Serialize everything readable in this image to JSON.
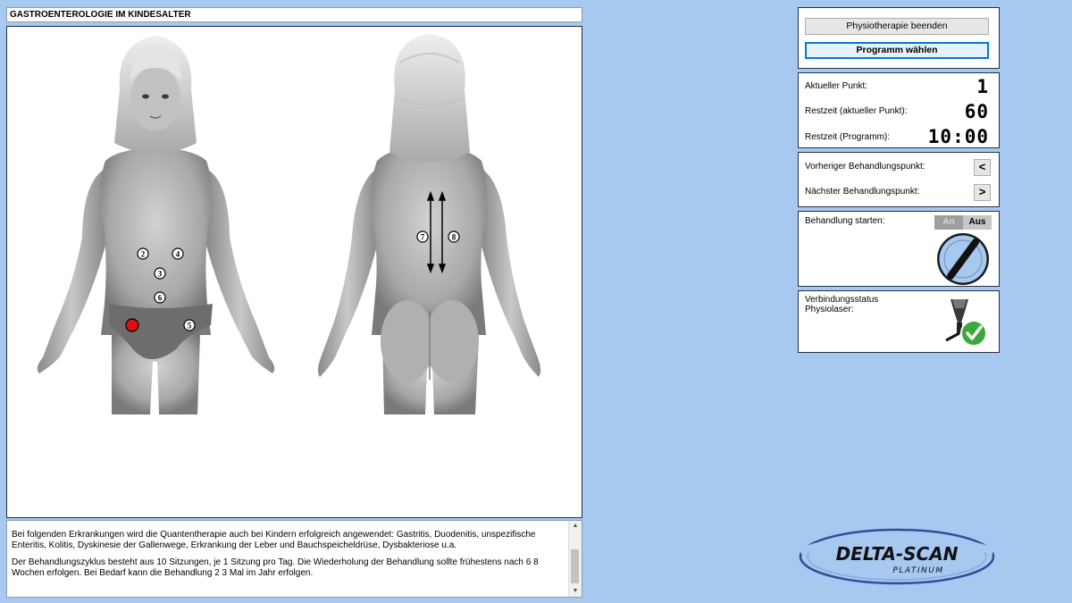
{
  "title": "GASTROENTEROLOGIE IM KINDESALTER",
  "points_front": [
    {
      "n": "2",
      "active": false
    },
    {
      "n": "4",
      "active": false
    },
    {
      "n": "3",
      "active": false
    },
    {
      "n": "6",
      "active": false
    },
    {
      "n": "1",
      "active": true
    },
    {
      "n": "5",
      "active": false
    }
  ],
  "points_back": [
    "7",
    "8"
  ],
  "description": {
    "p1": "Bei folgenden Erkrankungen wird die Quantentherapie auch bei Kindern erfolgreich angewendet: Gastritis, Duodenitis, unspezifische Enteritis, Kolitis, Dyskinesie der Gallenwege, Erkrankung der Leber und Bauchspeicheldrüse, Dysbakteriose u.a.",
    "p2": "Der Behandlungszyklus besteht aus 10 Sitzungen, je 1 Sitzung pro Tag. Die Wiederholung der Behandlung sollte frühestens nach 6  8 Wochen erfolgen. Bei Bedarf kann die Behandlung 2  3 Mal im Jahr erfolgen."
  },
  "buttons": {
    "end_label": "Physiotherapie beenden",
    "program_label": "Programm wählen"
  },
  "status": {
    "current_point_label": "Aktueller Punkt:",
    "current_point_value": "1",
    "remaining_point_label": "Restzeit (aktueller Punkt):",
    "remaining_point_value": "60",
    "remaining_program_label": "Restzeit (Programm):",
    "remaining_program_value": "10:00"
  },
  "nav": {
    "prev_label": "Vorheriger Behandlungspunkt:",
    "prev_button": "<",
    "next_label": "Nächster Behandlungspunkt:",
    "next_button": ">"
  },
  "start": {
    "label": "Behandlung starten:",
    "on": "An",
    "off": "Aus",
    "state": "Aus"
  },
  "connection": {
    "label_line1": "Verbindungsstatus",
    "label_line2": "Physiolaser:",
    "status": "connected"
  },
  "logo": {
    "main": "DELTA-SCAN",
    "sub": "PLATINUM"
  },
  "colors": {
    "background": "#a7c8ef",
    "active_point": "#e01010",
    "ok_green": "#3aa83a",
    "primary_border": "#0078d7"
  }
}
